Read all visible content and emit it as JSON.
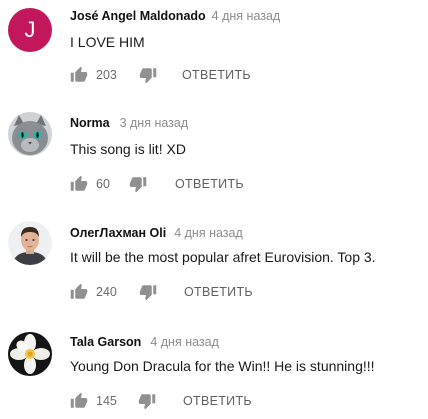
{
  "comments": [
    {
      "author": "José Angel Maldonado",
      "time": "4 дня назад",
      "avatar_letter": "J",
      "avatar_color": "#c2185b",
      "text": "I LOVE HIM",
      "likes": "203",
      "reply_label": "ОТВЕТИТЬ"
    },
    {
      "author": "Norma",
      "time": "3 дня назад",
      "avatar_icon": "gray-cat-photo",
      "text": "This song is lit! XD",
      "likes": "60",
      "reply_label": "ОТВЕТИТЬ"
    },
    {
      "author": "ОлегЛахман Oli",
      "time": "4 дня назад",
      "avatar_icon": "man-portrait-photo",
      "text": "It will be the most popular afret Eurovision. Top 3.",
      "likes": "240",
      "reply_label": "ОТВЕТИТЬ"
    },
    {
      "author": "Tala Garson",
      "time": "4 дня назад",
      "avatar_icon": "white-flower-photo",
      "text": "Young Don Dracula for the Win!! He is stunning!!!",
      "likes": "145",
      "reply_label": "ОТВЕТИТЬ"
    }
  ],
  "icons": {
    "like": "thumbs-up-icon",
    "dislike": "thumbs-down-icon"
  },
  "colors": {
    "time_gray": "#8c8c8c",
    "icon_gray": "#909090",
    "reply_gray": "#5f5f5f"
  }
}
